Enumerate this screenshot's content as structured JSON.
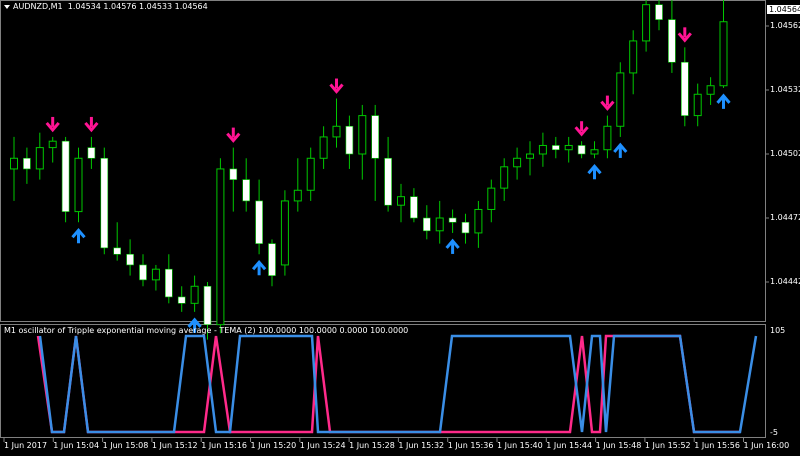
{
  "header": {
    "symbol": "AUDNZD,M1",
    "ohlc": "1.04534 1.04576 1.04533 1.04564"
  },
  "subwindow": {
    "title": "M1 oscillator of Tripple exponential moving average - TEMA (2) 100.0000 100.0000 0.0000 100.0000",
    "levels": [
      "105",
      "-5"
    ]
  },
  "price_axis": [
    "1.04562",
    "1.04532",
    "1.04502",
    "1.04472",
    "1.04442"
  ],
  "current_price": "1.04564",
  "time_axis": [
    "1 Jun 2017",
    "1 Jun 15:04",
    "1 Jun 15:08",
    "1 Jun 15:12",
    "1 Jun 15:16",
    "1 Jun 15:20",
    "1 Jun 15:24",
    "1 Jun 15:28",
    "1 Jun 15:32",
    "1 Jun 15:36",
    "1 Jun 15:40",
    "1 Jun 15:44",
    "1 Jun 15:48",
    "1 Jun 15:52",
    "1 Jun 15:56",
    "1 Jun 16:00"
  ],
  "colors": {
    "background": "#000000",
    "bull_outline": "#00c800",
    "bear_body": "#ffffff",
    "wick": "#00c800",
    "arrow_up": "#1e90ff",
    "arrow_down": "#ff1493",
    "osc_blue": "#3a8ee6",
    "osc_pink": "#ff2a8a"
  },
  "chart_data": {
    "type": "candlestick",
    "series": [
      {
        "name": "price",
        "ohlc": [
          [
            1.04495,
            1.0451,
            1.0448,
            1.045
          ],
          [
            1.045,
            1.04505,
            1.04488,
            1.04495
          ],
          [
            1.04495,
            1.04512,
            1.0449,
            1.04505
          ],
          [
            1.04505,
            1.0451,
            1.04498,
            1.04508
          ],
          [
            1.04508,
            1.0451,
            1.0447,
            1.04475
          ],
          [
            1.04475,
            1.04505,
            1.0447,
            1.045
          ],
          [
            1.04505,
            1.0451,
            1.04495,
            1.045
          ],
          [
            1.045,
            1.04505,
            1.04455,
            1.04458
          ],
          [
            1.04458,
            1.0447,
            1.04452,
            1.04455
          ],
          [
            1.04455,
            1.04462,
            1.04445,
            1.0445
          ],
          [
            1.0445,
            1.04455,
            1.0444,
            1.04443
          ],
          [
            1.04443,
            1.0445,
            1.04438,
            1.04448
          ],
          [
            1.04448,
            1.04455,
            1.04432,
            1.04435
          ],
          [
            1.04435,
            1.0444,
            1.04428,
            1.04432
          ],
          [
            1.04432,
            1.04445,
            1.04428,
            1.0444
          ],
          [
            1.0444,
            1.04442,
            1.04415,
            1.04422
          ],
          [
            1.04422,
            1.045,
            1.04418,
            1.04495
          ],
          [
            1.04495,
            1.04505,
            1.04475,
            1.0449
          ],
          [
            1.0449,
            1.045,
            1.04475,
            1.0448
          ],
          [
            1.0448,
            1.0449,
            1.04455,
            1.0446
          ],
          [
            1.0446,
            1.04462,
            1.0444,
            1.04445
          ],
          [
            1.0445,
            1.04485,
            1.04445,
            1.0448
          ],
          [
            1.0448,
            1.045,
            1.04475,
            1.04485
          ],
          [
            1.04485,
            1.04505,
            1.0448,
            1.045
          ],
          [
            1.045,
            1.04515,
            1.04495,
            1.0451
          ],
          [
            1.0451,
            1.04528,
            1.04505,
            1.04515
          ],
          [
            1.04515,
            1.0452,
            1.04495,
            1.04502
          ],
          [
            1.04502,
            1.04525,
            1.0449,
            1.0452
          ],
          [
            1.0452,
            1.04525,
            1.0448,
            1.045
          ],
          [
            1.045,
            1.0451,
            1.04475,
            1.04478
          ],
          [
            1.04478,
            1.04488,
            1.0447,
            1.04482
          ],
          [
            1.04482,
            1.04486,
            1.0447,
            1.04472
          ],
          [
            1.04472,
            1.04478,
            1.04462,
            1.04466
          ],
          [
            1.04466,
            1.0448,
            1.0446,
            1.04472
          ],
          [
            1.04472,
            1.04476,
            1.04465,
            1.0447
          ],
          [
            1.0447,
            1.04474,
            1.0446,
            1.04465
          ],
          [
            1.04465,
            1.0448,
            1.04458,
            1.04476
          ],
          [
            1.04476,
            1.0449,
            1.0447,
            1.04486
          ],
          [
            1.04486,
            1.045,
            1.0448,
            1.04496
          ],
          [
            1.04496,
            1.04505,
            1.0449,
            1.045
          ],
          [
            1.045,
            1.04508,
            1.04492,
            1.04502
          ],
          [
            1.04502,
            1.04512,
            1.04496,
            1.04506
          ],
          [
            1.04506,
            1.0451,
            1.045,
            1.04504
          ],
          [
            1.04504,
            1.0451,
            1.04498,
            1.04506
          ],
          [
            1.04506,
            1.04508,
            1.045,
            1.04502
          ],
          [
            1.04502,
            1.04508,
            1.045,
            1.04504
          ],
          [
            1.04504,
            1.0452,
            1.045,
            1.04515
          ],
          [
            1.04515,
            1.04545,
            1.0451,
            1.0454
          ],
          [
            1.0454,
            1.0456,
            1.0453,
            1.04555
          ],
          [
            1.04555,
            1.04575,
            1.0455,
            1.04572
          ],
          [
            1.04572,
            1.0458,
            1.0456,
            1.04565
          ],
          [
            1.04565,
            1.0458,
            1.0454,
            1.04545
          ],
          [
            1.04545,
            1.04552,
            1.04515,
            1.0452
          ],
          [
            1.0452,
            1.04535,
            1.04515,
            1.0453
          ],
          [
            1.0453,
            1.04538,
            1.04525,
            1.04534
          ],
          [
            1.04534,
            1.04576,
            1.04533,
            1.04564
          ]
        ]
      }
    ],
    "ylim": [
      1.04432,
      1.04572
    ]
  }
}
